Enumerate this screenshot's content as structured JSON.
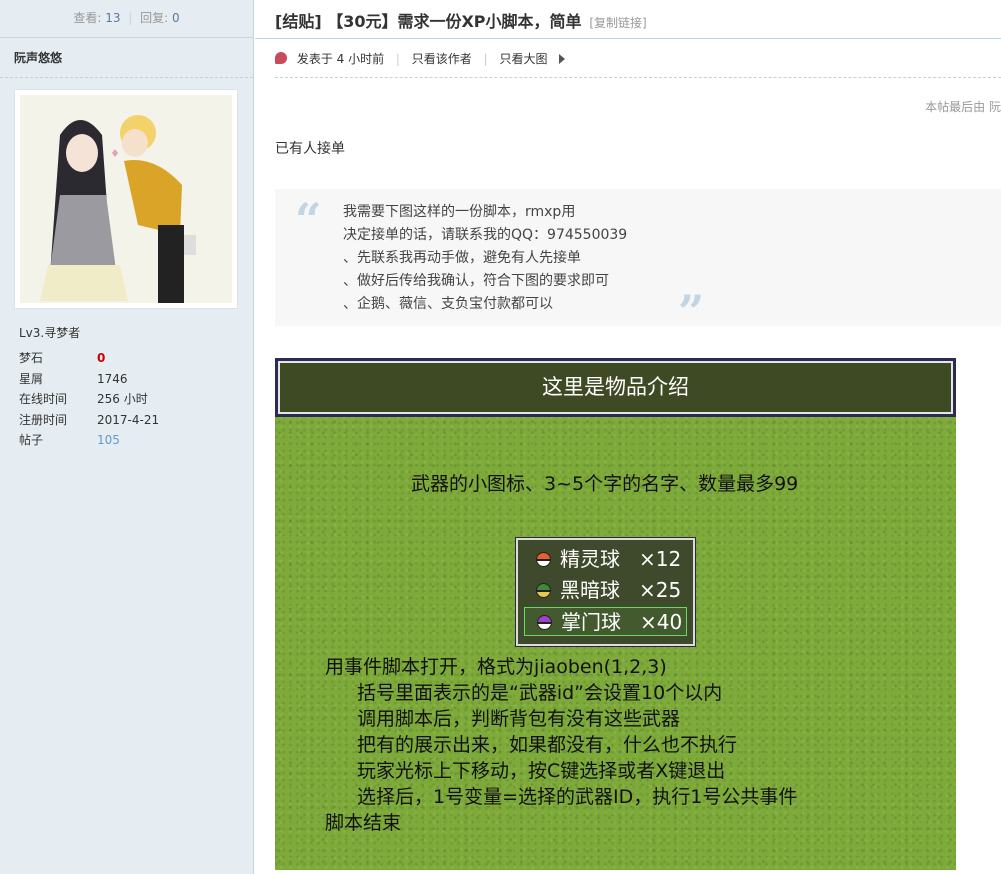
{
  "sidebar": {
    "views_label": "查看:",
    "views": "13",
    "replies_label": "回复:",
    "replies": "0",
    "author": "阮声悠悠",
    "level": "Lv3.寻梦者",
    "profile": [
      {
        "key": "梦石",
        "value": "0"
      },
      {
        "key": "星屑",
        "value": "1746"
      },
      {
        "key": "在线时间",
        "value": "256 小时"
      },
      {
        "key": "注册时间",
        "value": "2017-4-21"
      },
      {
        "key": "帖子",
        "value": "105"
      }
    ]
  },
  "thread": {
    "title": "[结贴] 【30元】需求一份XP小脚本，简单",
    "copy_link": "[复制链接]",
    "posted": "发表于 4 小时前",
    "only_author": "只看该作者",
    "big_image": "只看大图",
    "last_edited": "本帖最后由 阮",
    "taken_note": "已有人接单"
  },
  "quote": {
    "lines": [
      "我需要下图这样的一份脚本，rmxp用",
      "决定接单的话，请联系我的QQ：974550039",
      "、先联系我再动手做，避免有人先接单",
      "、做好后传给我确认，符合下图的要求即可",
      "、企鹅、薇信、支负宝付款都可以"
    ],
    "open_mark": "“",
    "close_mark": "”"
  },
  "game": {
    "header": "这里是物品介绍",
    "description": "武器的小图标、3~5个字的名字、数量最多99",
    "items": [
      {
        "name": "精灵球",
        "count": "×12",
        "icon": "pokeball-icon",
        "color": "#e8602c"
      },
      {
        "name": "黑暗球",
        "count": "×25",
        "icon": "dusk-ball-icon",
        "color": "#3e8a3a"
      },
      {
        "name": "掌门球",
        "count": "×40",
        "icon": "master-ball-icon",
        "color": "#a140c8"
      }
    ],
    "body_lines": [
      "用事件脚本打开，格式为jiaoben(1,2,3)",
      "括号里面表示的是“武器id”会设置10个以内",
      "调用脚本后，判断背包有没有这些武器",
      "把有的展示出来，如果都没有，什么也不执行",
      "玩家光标上下移动，按C键选择或者X键退出",
      "选择后，1号变量=选择的武器ID，执行1号公共事件",
      "脚本结束"
    ]
  },
  "colors": {
    "sidebar_bg": "#e5edf2",
    "border": "#c2d5e3",
    "accent_red": "#cc0000",
    "accent_blue": "#5f9bd1",
    "grass": "#7eaa3c"
  }
}
